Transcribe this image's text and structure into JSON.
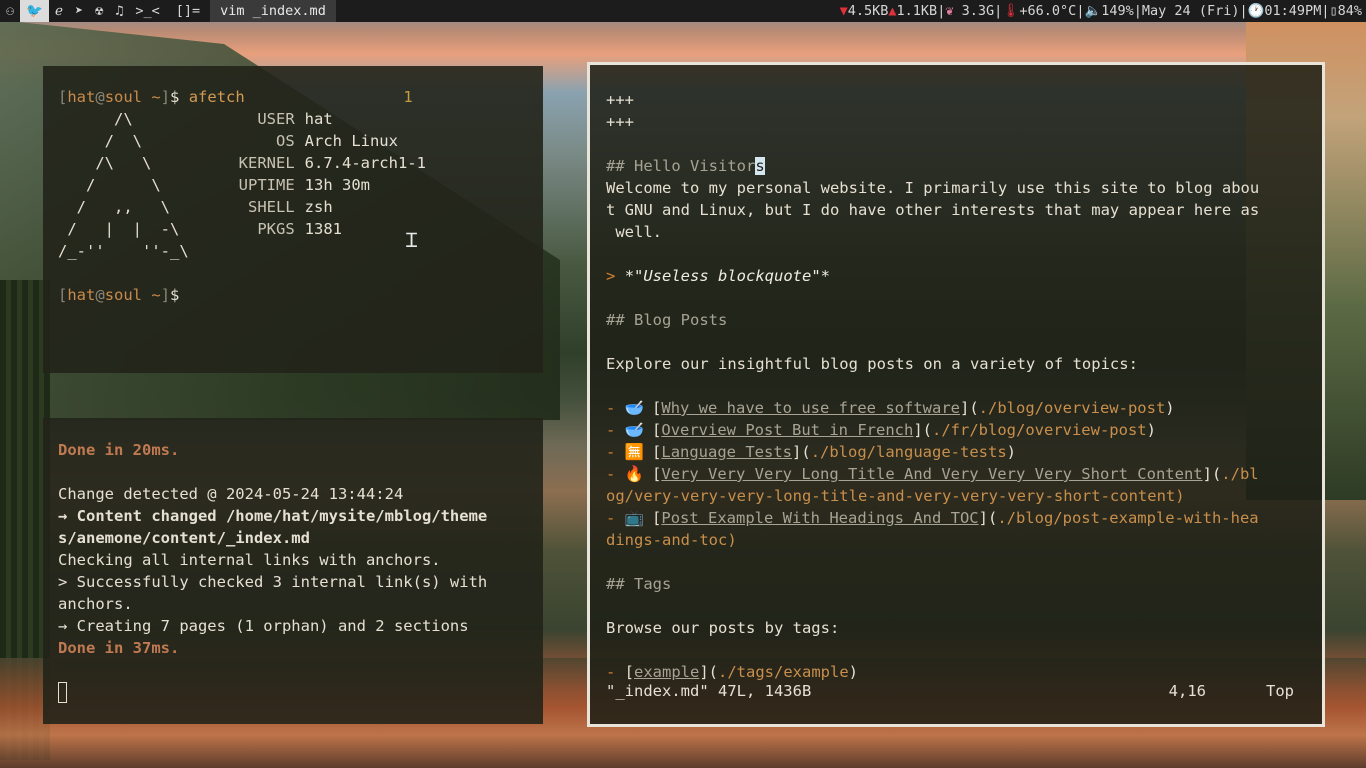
{
  "topbar": {
    "tags": [
      {
        "icon": "person-icon",
        "glyph": "⚇",
        "active": false
      },
      {
        "icon": "bird-icon",
        "glyph": "🐦",
        "active": true
      },
      {
        "icon": "browser-icon",
        "glyph": "ℯ",
        "active": false
      },
      {
        "icon": "telegram-icon",
        "glyph": "➤",
        "active": false
      },
      {
        "icon": "robot-icon",
        "glyph": "☢",
        "active": false
      },
      {
        "icon": "music-icon",
        "glyph": "♫",
        "active": false
      },
      {
        "icon": "terminal-icon",
        "glyph": ">_<",
        "active": false
      }
    ],
    "layout": "[]=",
    "window_title": "vim _index.md",
    "status": {
      "down": "4.5KB",
      "up": "1.1KB",
      "memory": "3.3G",
      "temp": "+66.0°C",
      "volume": "149%",
      "date": "May 24 (Fri)",
      "time": "01:49PM",
      "battery": "84%"
    }
  },
  "pane_afetch": {
    "prompt_user": "hat",
    "prompt_host": "soul",
    "prompt_dir": "~",
    "command": "afetch",
    "job_count": "1",
    "logo": [
      "      /\\",
      "     /  \\",
      "    /\\   \\",
      "   /      \\",
      "  /   ,,   \\",
      " /   |  |  -\\",
      "/_-''    ''-_\\"
    ],
    "info": [
      {
        "label": "USER",
        "value": "hat"
      },
      {
        "label": "OS",
        "value": "Arch Linux"
      },
      {
        "label": "KERNEL",
        "value": "6.7.4-arch1-1"
      },
      {
        "label": "UPTIME",
        "value": "13h 30m"
      },
      {
        "label": "SHELL",
        "value": "zsh"
      },
      {
        "label": "PKGS",
        "value": "1381"
      }
    ]
  },
  "pane_zola": {
    "done_first": "Done in 20ms.",
    "change_detected": "Change detected @ 2024-05-24 13:44:24",
    "content_changed_1": "→ Content changed /home/hat/mysite/mblog/theme",
    "content_changed_2": "s/anemone/content/_index.md",
    "checking": "Checking all internal links with anchors.",
    "success_1": "> Successfully checked 3 internal link(s) with",
    "success_2": "anchors.",
    "creating": "→ Creating 7 pages (1 orphan) and 2 sections",
    "done_second": "Done in 37ms."
  },
  "pane_vim": {
    "frontmatter_open": "+++",
    "frontmatter_close": "+++",
    "h_hello_prefix": "## Hello Visitor",
    "h_hello_cursor": "s",
    "welcome_1": "Welcome to my personal website. I primarily use this site to blog abou",
    "welcome_2": "t GNU and Linux, but I do have other interests that may appear here as",
    "welcome_3": " well.",
    "quote_marker": ">",
    "quote_text": "*\"Useless blockquote\"*",
    "h_blog": "## Blog Posts",
    "explore": "Explore our insightful blog posts on a variety of topics:",
    "posts": [
      {
        "emoji": "🥣",
        "title": "Why we have to use free software",
        "url": "./blog/overview-post",
        "wrap": ""
      },
      {
        "emoji": "🥣",
        "title": "Overview Post But in French",
        "url": "./fr/blog/overview-post",
        "wrap": ""
      },
      {
        "emoji": "🈚",
        "title": "Language Tests",
        "url": "./blog/language-tests",
        "wrap": ""
      },
      {
        "emoji": "🔥",
        "title": "Very Very Very Long Title And Very Very Very Short Content",
        "url": "./bl",
        "wrap": "og/very-very-very-long-title-and-very-very-very-short-content)"
      },
      {
        "emoji": "📺",
        "title": "Post Example With Headings And TOC",
        "url": "./blog/post-example-with-hea",
        "wrap": "dings-and-toc)"
      }
    ],
    "h_tags": "## Tags",
    "browse": "Browse our posts by tags:",
    "tag_item": {
      "title": "example",
      "url": "./tags/example"
    },
    "status_file": "\"_index.md\" 47L, 1436B",
    "status_pos": "4,16",
    "status_scroll": "Top"
  }
}
